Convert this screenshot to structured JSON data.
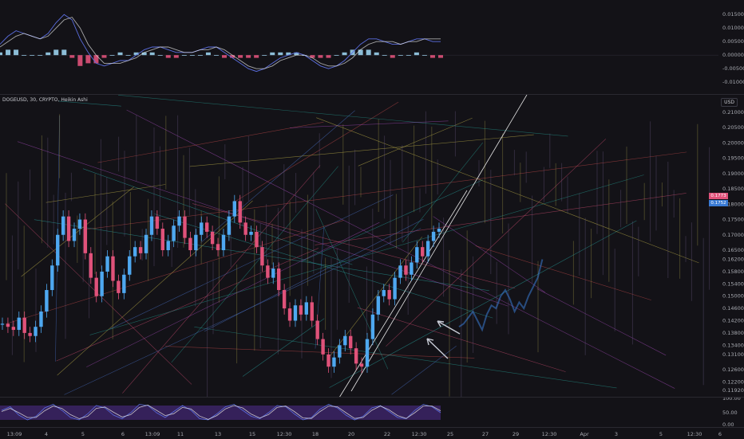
{
  "chart_data": [
    {
      "type": "line",
      "panel": "macd",
      "series": [
        {
          "values": [
            0.004,
            0.007,
            0.009,
            0.008,
            0.007,
            0.006,
            0.008,
            0.012,
            0.015,
            0.013,
            0.006,
            0.001,
            -0.003,
            -0.004,
            -0.003,
            -0.002,
            -0.002,
            0.0,
            0.002,
            0.003,
            0.003,
            0.002,
            0.001,
            0.001,
            0.001,
            0.002,
            0.003,
            0.003,
            0.001,
            -0.001,
            -0.003,
            -0.005,
            -0.006,
            -0.005,
            -0.003,
            -0.001,
            0.0,
            0.001,
            0.0,
            -0.002,
            -0.004,
            -0.005,
            -0.004,
            -0.002,
            0.001,
            0.004,
            0.006,
            0.006,
            0.005,
            0.004,
            0.004,
            0.005,
            0.006,
            0.006,
            0.005,
            0.005
          ]
        },
        {
          "values": [
            0.003,
            0.005,
            0.007,
            0.008,
            0.007,
            0.006,
            0.007,
            0.01,
            0.013,
            0.014,
            0.01,
            0.004,
            0.0,
            -0.003,
            -0.003,
            -0.003,
            -0.002,
            -0.001,
            0.001,
            0.002,
            0.003,
            0.003,
            0.002,
            0.001,
            0.001,
            0.002,
            0.002,
            0.003,
            0.002,
            0.0,
            -0.002,
            -0.004,
            -0.005,
            -0.005,
            -0.004,
            -0.002,
            -0.001,
            0.0,
            0.0,
            -0.001,
            -0.003,
            -0.004,
            -0.004,
            -0.003,
            -0.001,
            0.002,
            0.004,
            0.005,
            0.005,
            0.005,
            0.004,
            0.005,
            0.005,
            0.006,
            0.006,
            0.006
          ]
        }
      ],
      "histogram": [
        0.001,
        0.002,
        0.002,
        0.0,
        0.0,
        0.0,
        0.001,
        0.002,
        0.002,
        -0.001,
        -0.004,
        -0.003,
        -0.003,
        -0.001,
        0.0,
        0.001,
        0.0,
        0.001,
        0.001,
        0.001,
        0.0,
        -0.001,
        -0.001,
        0.0,
        0.0,
        0.0,
        0.001,
        0.0,
        -0.001,
        -0.001,
        -0.001,
        -0.001,
        -0.001,
        0.0,
        0.001,
        0.001,
        0.001,
        0.001,
        0.0,
        -0.001,
        -0.001,
        -0.001,
        0.0,
        0.001,
        0.002,
        0.002,
        0.002,
        0.001,
        0.0,
        -0.001,
        0.0,
        0.0,
        0.001,
        0.0,
        -0.001,
        -0.001
      ],
      "ylim": [
        -0.012,
        0.018
      ],
      "ticks": [
        "0.01500",
        "0.01000",
        "0.00500",
        "0.00000",
        "-0.00500",
        "-0.01000"
      ],
      "colors": {
        "macd_line": "#5b6ee0",
        "signal_line": "#e8e8e8",
        "hist_pos": "#9ad0ec",
        "hist_neg": "#e0527a"
      }
    },
    {
      "type": "heikin-ashi",
      "panel": "price",
      "title": "DOGEUSD, 30, CRYPTO, Heikin Ashi",
      "currency": "USD",
      "ylim": [
        0.119,
        0.211
      ],
      "ticks": [
        "0.21000",
        "0.20500",
        "0.20000",
        "0.19500",
        "0.19000",
        "0.18500",
        "0.18000",
        "0.17500",
        "0.17000",
        "0.16500",
        "0.16200",
        "0.15800",
        "0.15400",
        "0.15000",
        "0.14600",
        "0.14200",
        "0.13800",
        "0.13400",
        "0.13100",
        "0.12600",
        "0.12200",
        "0.11920"
      ],
      "close": [
        0.141,
        0.14,
        0.139,
        0.143,
        0.138,
        0.137,
        0.14,
        0.145,
        0.152,
        0.16,
        0.17,
        0.176,
        0.168,
        0.172,
        0.175,
        0.164,
        0.156,
        0.15,
        0.158,
        0.163,
        0.155,
        0.151,
        0.157,
        0.163,
        0.166,
        0.164,
        0.17,
        0.176,
        0.172,
        0.165,
        0.168,
        0.173,
        0.176,
        0.169,
        0.165,
        0.17,
        0.174,
        0.171,
        0.167,
        0.165,
        0.17,
        0.176,
        0.181,
        0.174,
        0.17,
        0.171,
        0.166,
        0.16,
        0.156,
        0.159,
        0.152,
        0.146,
        0.142,
        0.147,
        0.144,
        0.148,
        0.142,
        0.136,
        0.131,
        0.127,
        0.13,
        0.134,
        0.137,
        0.133,
        0.128,
        0.127,
        0.136,
        0.144,
        0.15,
        0.152,
        0.149,
        0.156,
        0.16,
        0.157,
        0.161,
        0.166,
        0.163,
        0.168,
        0.171,
        0.172
      ],
      "ghost_close": [
        0.14,
        0.141,
        0.143,
        0.145,
        0.142,
        0.139,
        0.144,
        0.147,
        0.146,
        0.15,
        0.152,
        0.149,
        0.145,
        0.148,
        0.146,
        0.15,
        0.153,
        0.156,
        0.162
      ],
      "price_tags": [
        {
          "value": "0.1773",
          "color": "#e0527a"
        },
        {
          "value": "0.1752",
          "color": "#3a7bd5"
        }
      ],
      "colors": {
        "up": "#4ea8f0",
        "down": "#e0527a"
      }
    },
    {
      "type": "line",
      "panel": "stochastic",
      "series": [
        {
          "values": [
            60,
            75,
            40,
            20,
            35,
            70,
            85,
            60,
            30,
            20,
            45,
            80,
            70,
            40,
            25,
            50,
            85,
            80,
            50,
            30,
            55,
            80,
            60,
            25,
            20,
            45,
            75,
            85,
            60,
            35,
            25,
            50,
            80,
            75,
            45,
            20,
            30,
            65,
            85,
            70,
            40,
            20,
            35,
            70,
            80,
            55,
            30,
            25,
            60,
            85,
            75,
            50
          ]
        },
        {
          "values": [
            55,
            68,
            50,
            30,
            30,
            58,
            78,
            68,
            42,
            25,
            35,
            68,
            74,
            52,
            32,
            42,
            72,
            82,
            60,
            38,
            46,
            72,
            66,
            36,
            22,
            38,
            66,
            80,
            70,
            44,
            28,
            42,
            72,
            78,
            55,
            28,
            26,
            55,
            78,
            75,
            50,
            26,
            30,
            60,
            78,
            62,
            38,
            26,
            50,
            78,
            78,
            58
          ]
        }
      ],
      "ylim": [
        0,
        100
      ],
      "ticks": [
        "50.00",
        "0.00"
      ],
      "colors": {
        "k": "#5b6ee0",
        "d": "#e8e8e8",
        "band": "#3c2466"
      }
    }
  ],
  "time_axis": [
    "13:09",
    "4",
    "5",
    "6",
    "13:09",
    "11",
    "13",
    "15",
    "12:30",
    "18",
    "20",
    "22",
    "12:30",
    "25",
    "27",
    "29",
    "12:30",
    "Apr",
    "3",
    "5",
    "12:30",
    "6"
  ],
  "axis_labels": {
    "macd_top": "0.01500",
    "stoch_top": "100.00"
  }
}
